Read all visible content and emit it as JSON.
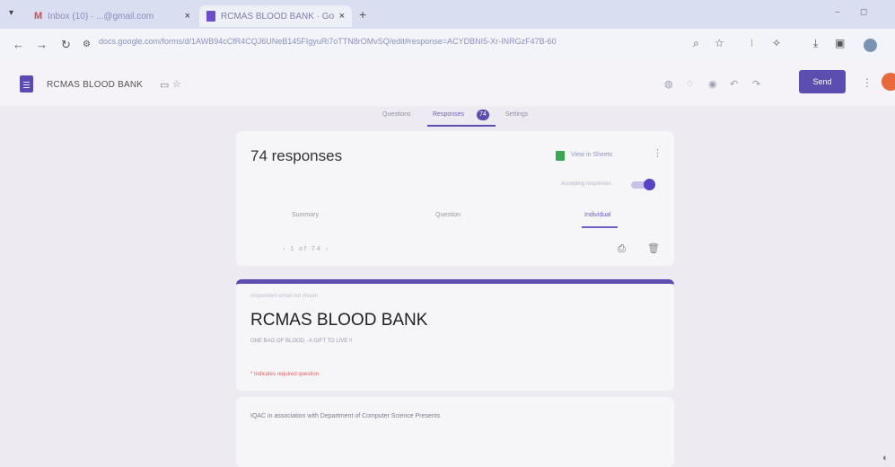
{
  "browser": {
    "tabs": [
      {
        "title": "Inbox (10) · ...@gmail.com",
        "favicon": "gmail-icon"
      },
      {
        "title": "RCMAS BLOOD BANK · Goog",
        "favicon": "forms-icon",
        "active": true
      }
    ],
    "url": "docs.google.com/forms/d/1AWB94cCfR4CQJ6UNeB145FIgyuRi7oTTN8rOMvSQ/edit#response=ACYDBNI5-Xr-INRGzF47B-60"
  },
  "app": {
    "doc_title": "RCMAS BLOOD BANK",
    "send_label": "Send",
    "accent_color": "#5c4db1"
  },
  "form_tabs": {
    "questions": "Questions",
    "responses": "Responses",
    "responses_count": "74",
    "settings": "Settings"
  },
  "responses_card": {
    "title": "74 responses",
    "sheets_link": "View in Sheets",
    "accepting_label": "Accepting responses",
    "sub_tabs": [
      "Summary",
      "Question",
      "Individual"
    ],
    "pager": "‹ 1 of 74 ›"
  },
  "form_header": {
    "email_label": "respondent email not shown",
    "title": "RCMAS BLOOD BANK",
    "description": "ONE BAG OF BLOOD - A GIFT TO LIVE !!",
    "required_note": "* Indicates required question"
  },
  "iqac": {
    "text": "IQAC in association with Department of Computer Science Presents"
  }
}
